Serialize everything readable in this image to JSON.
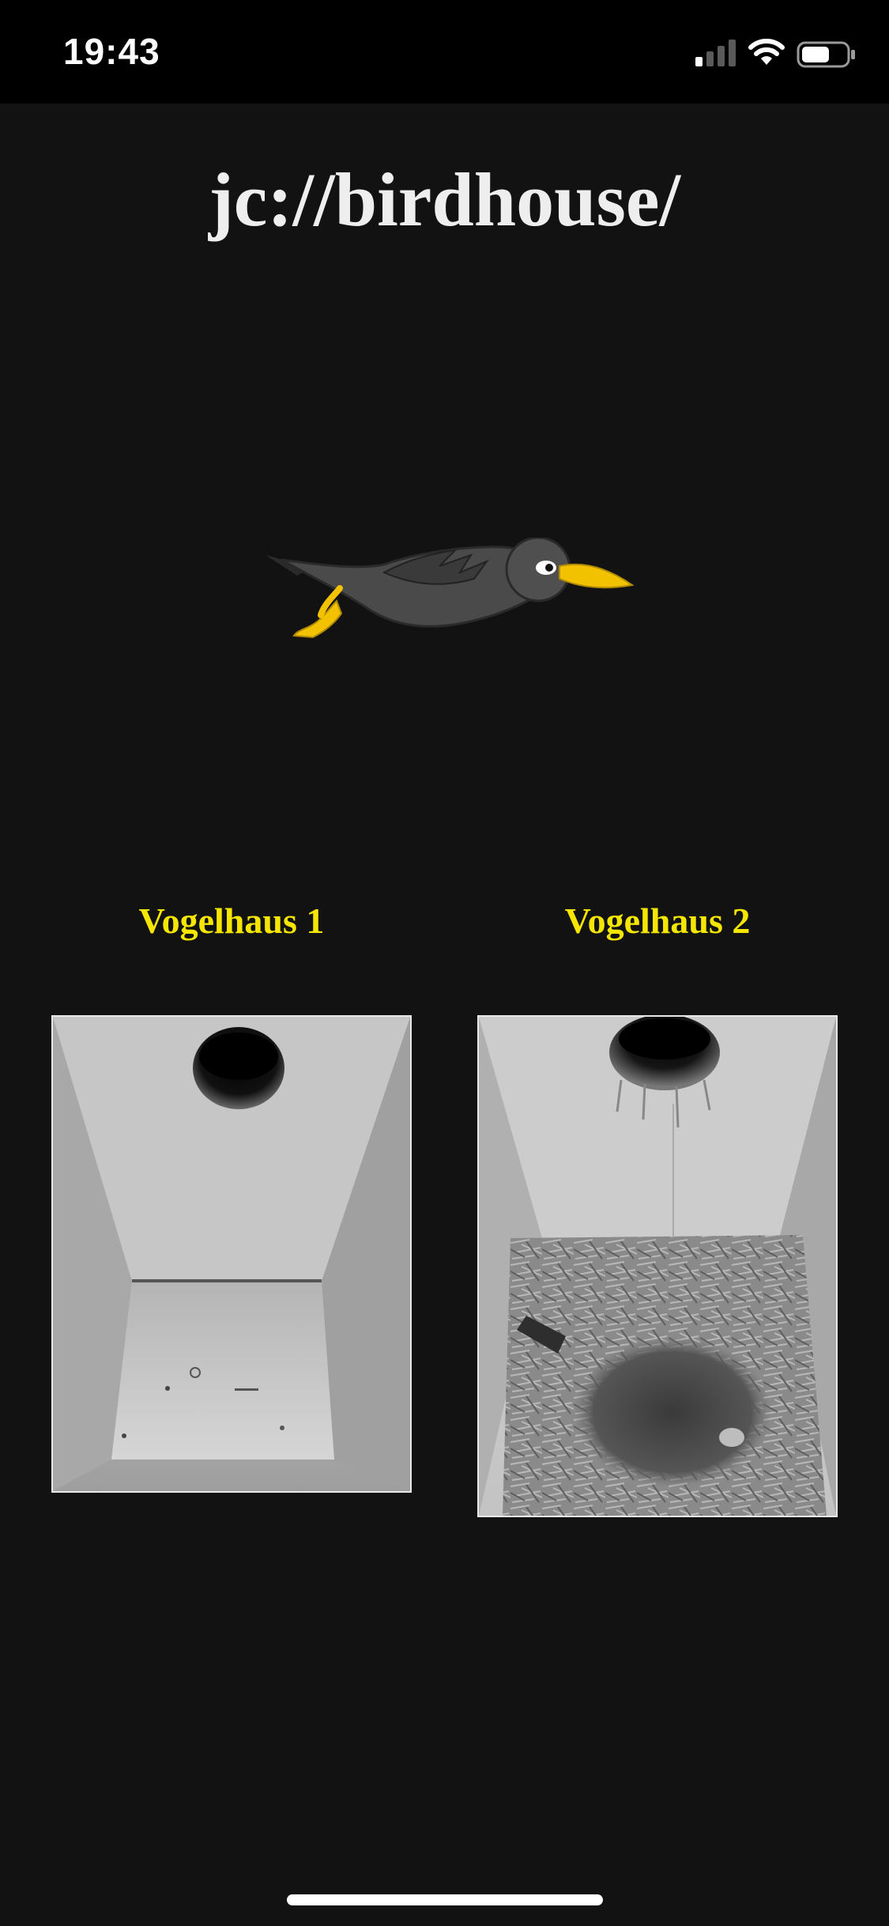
{
  "status_bar": {
    "time": "19:43"
  },
  "header": {
    "title": "jc://birdhouse/"
  },
  "houses": [
    {
      "label": "Vogelhaus 1"
    },
    {
      "label": "Vogelhaus 2"
    }
  ],
  "colors": {
    "background": "#121212",
    "title": "#eeeeee",
    "label": "#f5e600",
    "beak": "#f2c200"
  },
  "icons": {
    "signal": "cellular-signal-icon",
    "wifi": "wifi-icon",
    "battery": "battery-icon",
    "logo": "flying-bird-logo"
  }
}
